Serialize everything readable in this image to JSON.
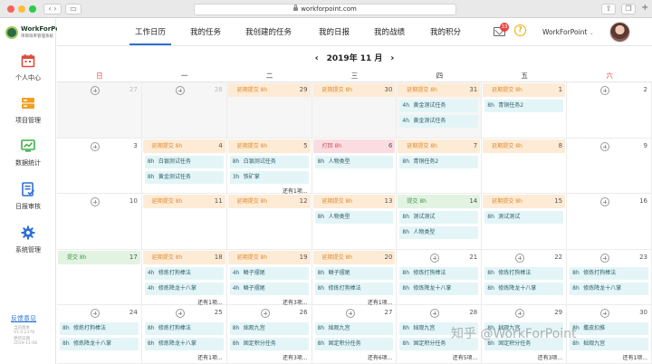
{
  "browser": {
    "url": "workforpoint.com"
  },
  "brand": {
    "name": "WorkForPoint",
    "subtitle": "项目效率管理系统"
  },
  "sidebar": {
    "items": [
      {
        "label": "个人中心",
        "icon": "calendar-icon",
        "color": "#e24a3b"
      },
      {
        "label": "项目管理",
        "icon": "project-icon",
        "color": "#f0a020"
      },
      {
        "label": "数据统计",
        "icon": "chart-icon",
        "color": "#3fae49"
      },
      {
        "label": "日报审核",
        "icon": "review-icon",
        "color": "#2f6fd8"
      },
      {
        "label": "系统管理",
        "icon": "gear-icon",
        "color": "#2f6fd8"
      }
    ],
    "feedback": "反馈意见",
    "version_lines": [
      "当前版本",
      "V1.0.2378",
      "更新日期",
      "2019-11-06"
    ]
  },
  "header": {
    "tabs": [
      "工作日历",
      "我的任务",
      "我创建的任务",
      "我的日报",
      "我的战绩",
      "我的积分"
    ],
    "active_tab": 0,
    "mail_count": "33",
    "user_name": "WorkForPoint"
  },
  "calendar": {
    "title": "2019年 11 月",
    "weekdays": [
      "日",
      "一",
      "二",
      "三",
      "四",
      "五",
      "六"
    ],
    "weeks": [
      [
        {
          "day": "27",
          "other": true
        },
        {
          "day": "28",
          "other": true
        },
        {
          "day": "29",
          "other": true,
          "pill": {
            "text": "延期提交 8h",
            "kind": "orange"
          }
        },
        {
          "day": "30",
          "other": true,
          "pill": {
            "text": "延期提交 8h",
            "kind": "orange"
          }
        },
        {
          "day": "31",
          "other": true,
          "pill": {
            "text": "延期提交 8h",
            "kind": "orange"
          },
          "events": [
            {
              "h": "4h",
              "t": "黄金测试任务"
            },
            {
              "h": "4h",
              "t": "黄金测试任务"
            }
          ]
        },
        {
          "day": "1",
          "pill": {
            "text": "延期提交 8h",
            "kind": "orange"
          },
          "events": [
            {
              "h": "8h",
              "t": "青铜任务2"
            }
          ]
        },
        {
          "day": "2"
        }
      ],
      [
        {
          "day": "3"
        },
        {
          "day": "4",
          "pill": {
            "text": "延期提交 8h",
            "kind": "orange"
          },
          "events": [
            {
              "h": "8h",
              "t": "白银测试任务"
            },
            {
              "h": "8h",
              "t": "黄金测试任务"
            }
          ]
        },
        {
          "day": "5",
          "pill": {
            "text": "延期提交 8h",
            "kind": "orange"
          },
          "events": [
            {
              "h": "8h",
              "t": "白银测试任务"
            },
            {
              "h": "3h",
              "t": "铁矿掌"
            }
          ],
          "more": "还有1项..."
        },
        {
          "day": "6",
          "pill": {
            "text": "打回 8h",
            "kind": "red"
          },
          "events": [
            {
              "h": "8h",
              "t": "人物类型"
            }
          ]
        },
        {
          "day": "7",
          "pill": {
            "text": "延期提交 8h",
            "kind": "orange"
          },
          "events": [
            {
              "h": "8h",
              "t": "青铜任务2"
            }
          ]
        },
        {
          "day": "8",
          "pill": {
            "text": "延期提交 8h",
            "kind": "orange"
          }
        },
        {
          "day": "9"
        }
      ],
      [
        {
          "day": "10"
        },
        {
          "day": "11",
          "pill": {
            "text": "延期提交 8h",
            "kind": "orange"
          }
        },
        {
          "day": "12",
          "pill": {
            "text": "延期提交 8h",
            "kind": "orange"
          }
        },
        {
          "day": "13",
          "pill": {
            "text": "延期提交 8h",
            "kind": "orange"
          },
          "events": [
            {
              "h": "8h",
              "t": "人物类型"
            }
          ]
        },
        {
          "day": "14",
          "pill": {
            "text": "提交 8h",
            "kind": "green"
          },
          "events": [
            {
              "h": "8h",
              "t": "测试测试"
            },
            {
              "h": "8h",
              "t": "人物类型"
            }
          ]
        },
        {
          "day": "15",
          "pill": {
            "text": "延期提交 8h",
            "kind": "orange"
          },
          "events": [
            {
              "h": "8h",
              "t": "测试测试"
            }
          ]
        },
        {
          "day": "16"
        }
      ],
      [
        {
          "day": "17",
          "pill": {
            "text": "提交 8h",
            "kind": "green"
          }
        },
        {
          "day": "18",
          "pill": {
            "text": "延期提交 8h",
            "kind": "orange"
          },
          "events": [
            {
              "h": "4h",
              "t": "修炼打狗棒法"
            },
            {
              "h": "4h",
              "t": "修炼降龙十八掌"
            }
          ],
          "more": "还有1项..."
        },
        {
          "day": "19",
          "pill": {
            "text": "延期提交 8h",
            "kind": "orange"
          },
          "events": [
            {
              "h": "4h",
              "t": "鳞子摆尾"
            },
            {
              "h": "4h",
              "t": "鳞子摆尾"
            }
          ],
          "more": "还有3项..."
        },
        {
          "day": "20",
          "pill": {
            "text": "延期提交 8h",
            "kind": "orange"
          },
          "events": [
            {
              "h": "8h",
              "t": "鳞子摆尾"
            },
            {
              "h": "8h",
              "t": "修炼打狗棒法"
            }
          ],
          "more": "还有1项..."
        },
        {
          "day": "21",
          "events": [
            {
              "h": "8h",
              "t": "修炼打狗棒法"
            },
            {
              "h": "8h",
              "t": "修炼降龙十八掌"
            }
          ]
        },
        {
          "day": "22",
          "events": [
            {
              "h": "8h",
              "t": "修炼打狗棒法"
            },
            {
              "h": "8h",
              "t": "修炼降龙十八掌"
            }
          ]
        },
        {
          "day": "23",
          "events": [
            {
              "h": "8h",
              "t": "修炼打狗棒法"
            },
            {
              "h": "8h",
              "t": "修炼降龙十八掌"
            }
          ]
        }
      ],
      [
        {
          "day": "24",
          "events": [
            {
              "h": "8h",
              "t": "修炼打狗棒法"
            },
            {
              "h": "8h",
              "t": "修炼降龙十八掌"
            }
          ]
        },
        {
          "day": "25",
          "events": [
            {
              "h": "8h",
              "t": "修炼打狗棒法"
            },
            {
              "h": "8h",
              "t": "修炼降龙十八掌"
            }
          ],
          "more": "还有1项..."
        },
        {
          "day": "26",
          "events": [
            {
              "h": "8h",
              "t": "拙观九宫"
            },
            {
              "h": "8h",
              "t": "固定积分任务"
            }
          ],
          "more": "还有3项..."
        },
        {
          "day": "27",
          "events": [
            {
              "h": "8h",
              "t": "拙观九宫"
            },
            {
              "h": "8h",
              "t": "固定积分任务"
            }
          ],
          "more": "还有6项..."
        },
        {
          "day": "28",
          "events": [
            {
              "h": "8h",
              "t": "拙观九宫"
            },
            {
              "h": "8h",
              "t": "固定积分任务"
            }
          ],
          "more": "还有5项..."
        },
        {
          "day": "29",
          "events": [
            {
              "h": "8h",
              "t": "拙观九宫"
            },
            {
              "h": "8h",
              "t": "固定积分任务"
            }
          ],
          "more": "还有3项..."
        },
        {
          "day": "30",
          "events": [
            {
              "h": "8h",
              "t": "撒皮扣推"
            },
            {
              "h": "8h",
              "t": "拙观九宫"
            }
          ],
          "more": "还有1项..."
        }
      ]
    ]
  },
  "watermark": "知乎 @WorkForPoint"
}
